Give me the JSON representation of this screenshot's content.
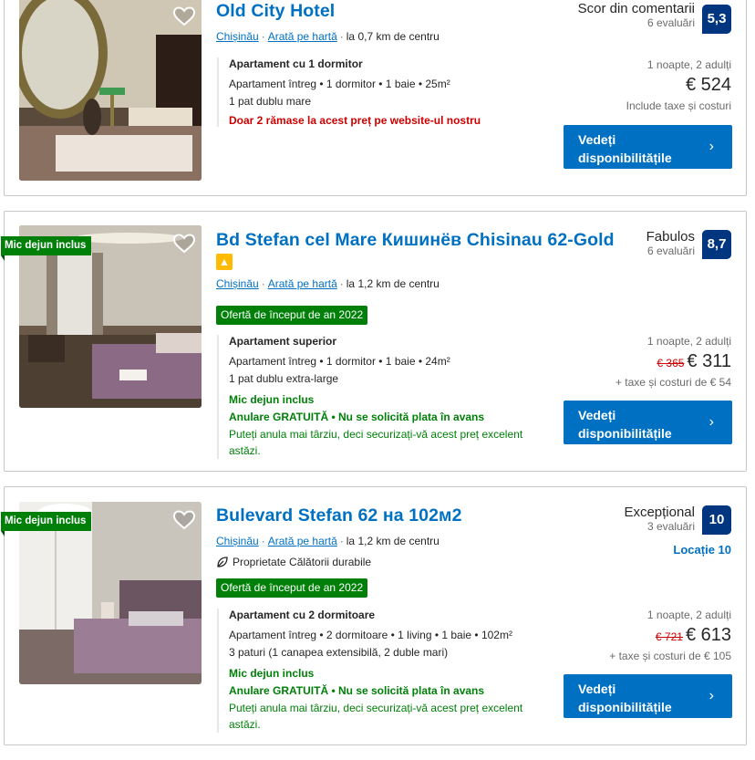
{
  "colors": {
    "brand_blue": "#0071c2",
    "score_blue": "#003580",
    "green": "#008009",
    "red": "#cc0000"
  },
  "listings": [
    {
      "title": "Old City Hotel",
      "city": "Chișinău",
      "map_link": "Arată pe hartă",
      "distance": "la 0,7 km de centru",
      "score_label": "Scor din comentarii",
      "review_count": "6 evaluări",
      "score": "5,3",
      "room_title": "Apartament cu 1 dormitor",
      "room_details": "Apartament întreg • 1 dormitor • 1 baie • 25m²",
      "bed": "1 pat dublu mare",
      "scarcity": "Doar 2 rămase la acest preț pe website-ul nostru",
      "nights": "1 noapte, 2 adulți",
      "price": "€ 524",
      "taxes": "Include taxe și costuri",
      "button": "Vedeți disponibilitățile"
    },
    {
      "ribbon": "Mic dejun inclus",
      "title": "Bd Stefan cel Mare Кишинёв Chisinau 62-Gold",
      "city": "Chișinău",
      "map_link": "Arată pe hartă",
      "distance": "la 1,2 km de centru",
      "deal": "Ofertă de început de an 2022",
      "score_label": "Fabulos",
      "review_count": "6 evaluări",
      "score": "8,7",
      "room_title": "Apartament superior",
      "room_details": "Apartament întreg • 1 dormitor • 1 baie • 24m²",
      "bed": "1 pat dublu extra-large",
      "breakfast": "Mic dejun inclus",
      "cancellation": "Anulare GRATUITĂ • Nu se solicită plata în avans",
      "cancel_note": "Puteți anula mai târziu, deci securizați-vă acest preț excelent astăzi.",
      "nights": "1 noapte, 2 adulți",
      "old_price": "€ 365",
      "price": "€ 311",
      "taxes": "+ taxe și costuri de € 54",
      "button": "Vedeți disponibilitățile"
    },
    {
      "ribbon": "Mic dejun inclus",
      "title": "Bulevard Stefan 62 на 102м2",
      "city": "Chișinău",
      "map_link": "Arată pe hartă",
      "distance": "la 1,2 km de centru",
      "sustainable": "Proprietate Călătorii durabile",
      "deal": "Ofertă de început de an 2022",
      "score_label": "Excepțional",
      "review_count": "3 evaluări",
      "score": "10",
      "location_score": "Locație 10",
      "room_title": "Apartament cu 2 dormitoare",
      "room_details": "Apartament întreg • 2 dormitoare • 1 living • 1 baie • 102m²",
      "bed": "3 paturi (1 canapea extensibilă, 2 duble mari)",
      "breakfast": "Mic dejun inclus",
      "cancellation": "Anulare GRATUITĂ • Nu se solicită plata în avans",
      "cancel_note": "Puteți anula mai târziu, deci securizați-vă acest preț excelent astăzi.",
      "nights": "1 noapte, 2 adulți",
      "old_price": "€ 721",
      "price": "€ 613",
      "taxes": "+ taxe și costuri de € 105",
      "button": "Vedeți disponibilitățile"
    }
  ]
}
